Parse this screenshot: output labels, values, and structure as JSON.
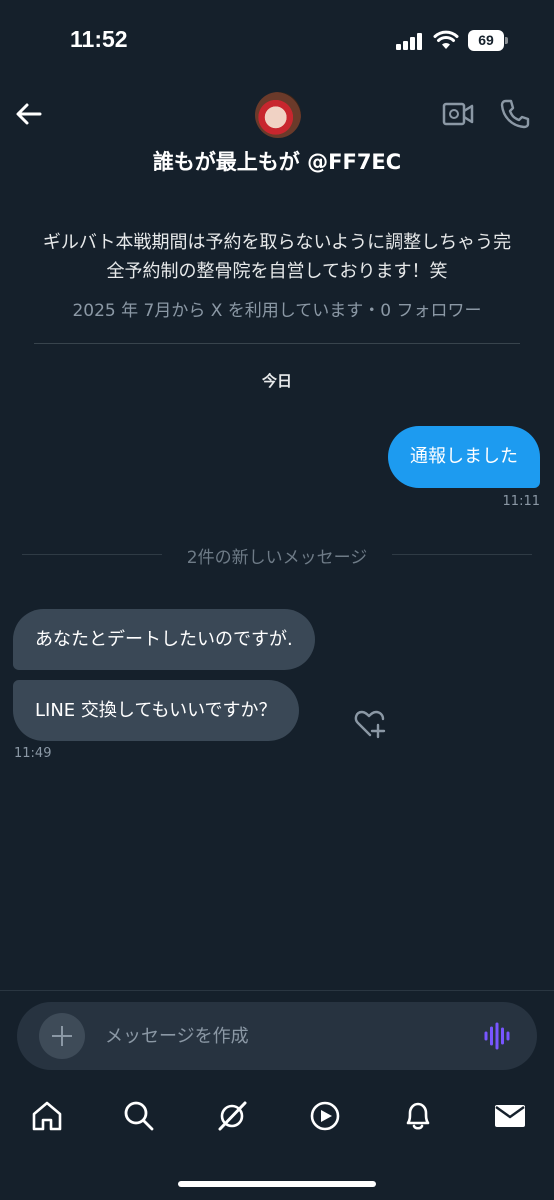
{
  "status_bar": {
    "time": "11:52",
    "battery_level": "69"
  },
  "header": {
    "back_icon": "arrow-left-icon",
    "video_icon": "video-call-icon",
    "phone_icon": "phone-icon"
  },
  "profile": {
    "name": "誰もが最上もが @FF7EC",
    "bio": "ギルバト本戦期間は予約を取らないように調整しちゃう完全予約制の整骨院を自営しております！笑",
    "meta": "2025 年 7月から X を利用しています・0 フォロワー"
  },
  "conversation": {
    "date_label": "今日",
    "outgoing": [
      {
        "text": "通報しました",
        "time": "11:11"
      }
    ],
    "new_messages_label": "2件の新しいメッセージ",
    "incoming": [
      {
        "text": "あなたとデートしたいのですが."
      },
      {
        "text": "LINE 交換してもいいですか？"
      }
    ],
    "incoming_time": "11:49"
  },
  "composer": {
    "placeholder": "メッセージを作成"
  },
  "bottom_nav": [
    "home-icon",
    "search-icon",
    "grok-icon",
    "video-play-icon",
    "bell-icon",
    "mail-icon"
  ],
  "colors": {
    "background": "#15202b",
    "accent": "#1d9bf0",
    "incoming_bubble": "#3a4856",
    "voice": "#7856ff"
  }
}
